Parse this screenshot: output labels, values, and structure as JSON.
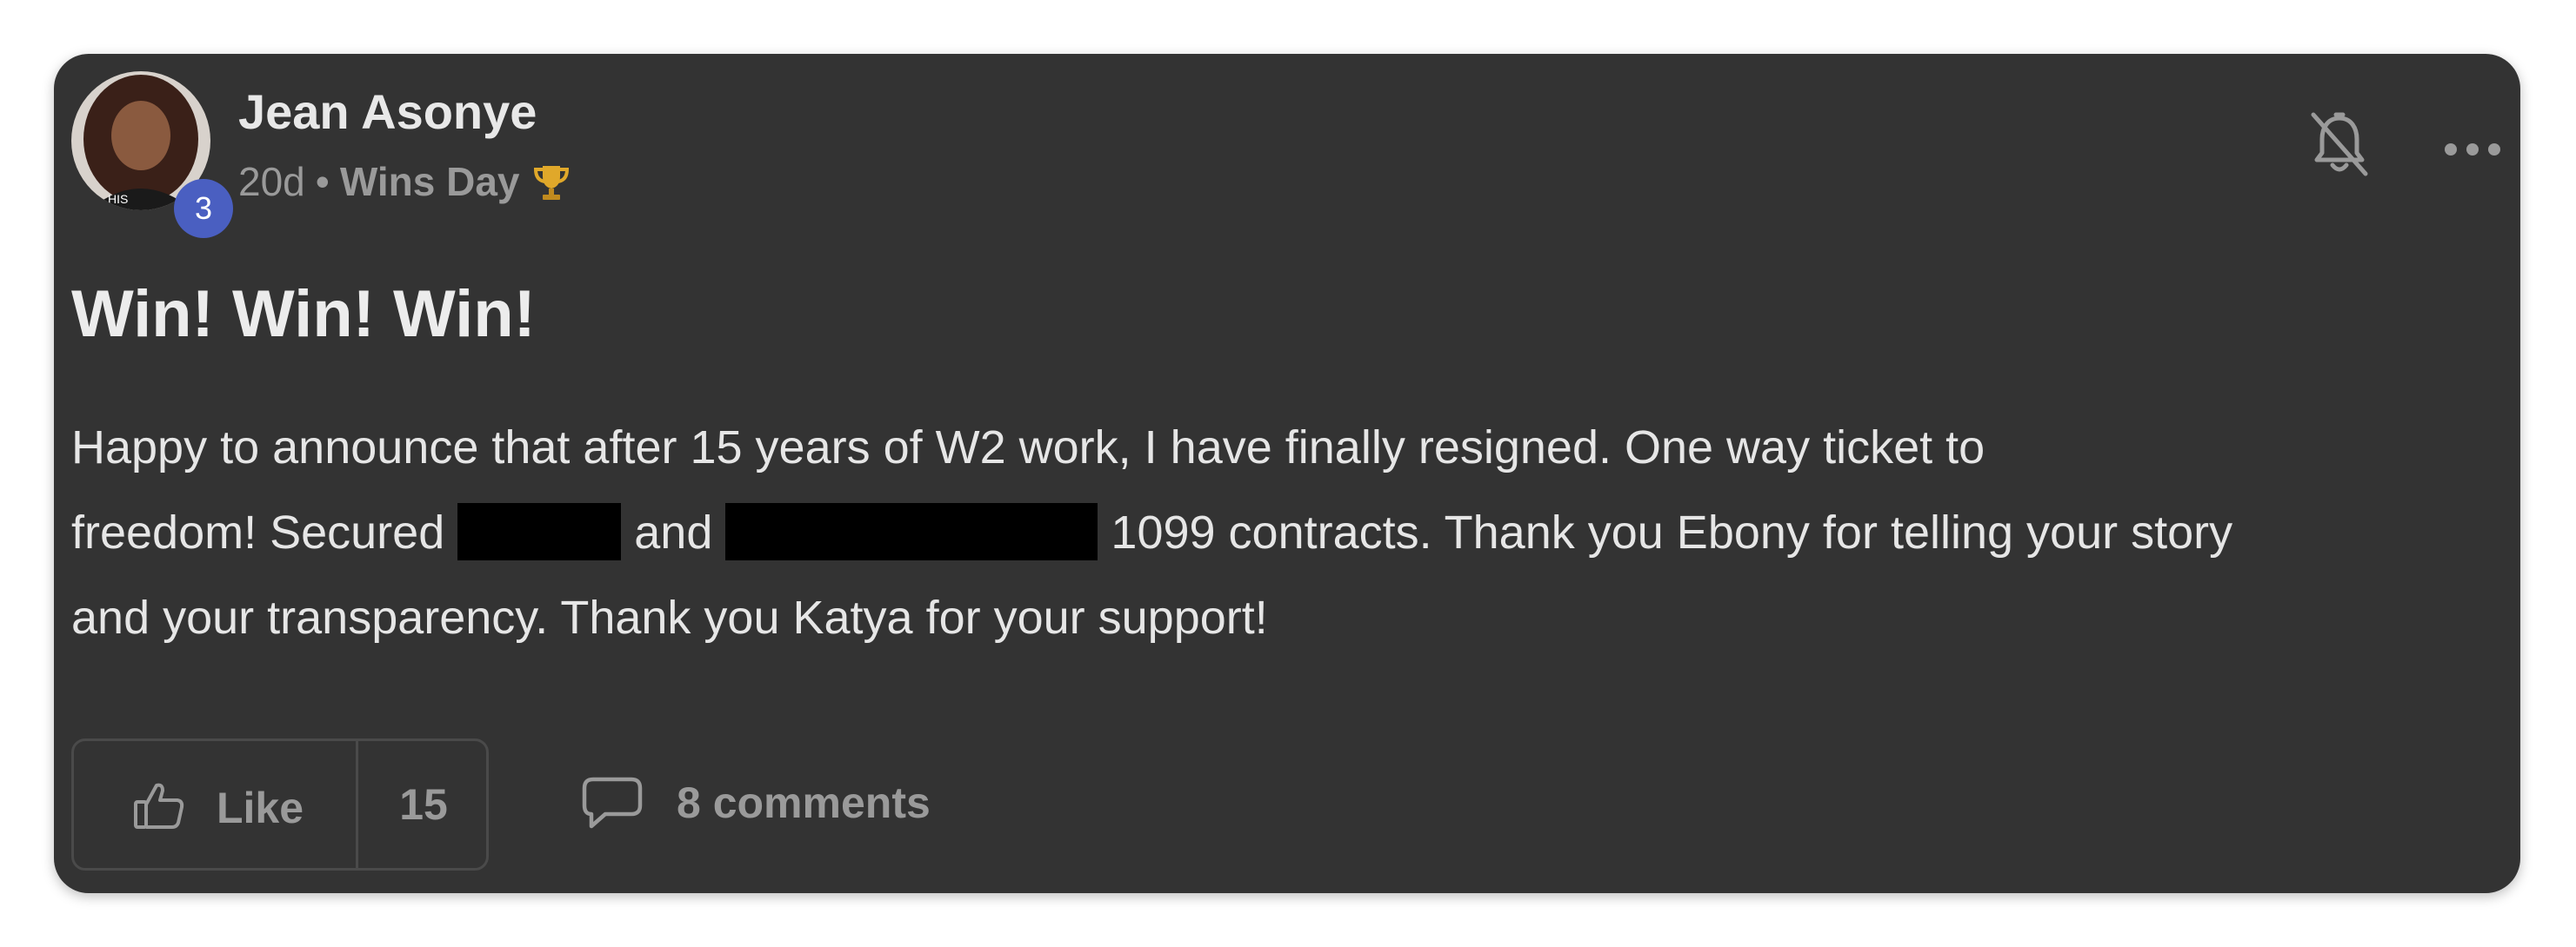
{
  "post": {
    "author": {
      "name": "Jean Asonye",
      "level": "3",
      "avatar_shirt_text": "HIS"
    },
    "meta": {
      "time": "20d",
      "separator": "•",
      "category": "Wins Day",
      "category_icon": "trophy-icon"
    },
    "title": "Win! Win! Win!",
    "body": {
      "line1": "Happy to announce that after 15 years of W2 work, I have finally resigned. One way ticket to",
      "line2_a": "freedom! Secured",
      "line2_b": "and",
      "line2_c": "1099 contracts. Thank you Ebony for telling your story",
      "line3": "and your transparency. Thank you Katya for your support!"
    },
    "actions": {
      "like_label": "Like",
      "like_count": "15",
      "comments_label": "8 comments"
    },
    "icons": {
      "notifications": "bell-off-icon",
      "more": "more-options-icon",
      "like": "thumbs-up-icon",
      "comments": "comment-bubble-icon"
    }
  },
  "colors": {
    "card_background": "#333333",
    "badge": "#4a5fc1",
    "muted_text": "#9a9a9a",
    "redaction": "#000000"
  }
}
